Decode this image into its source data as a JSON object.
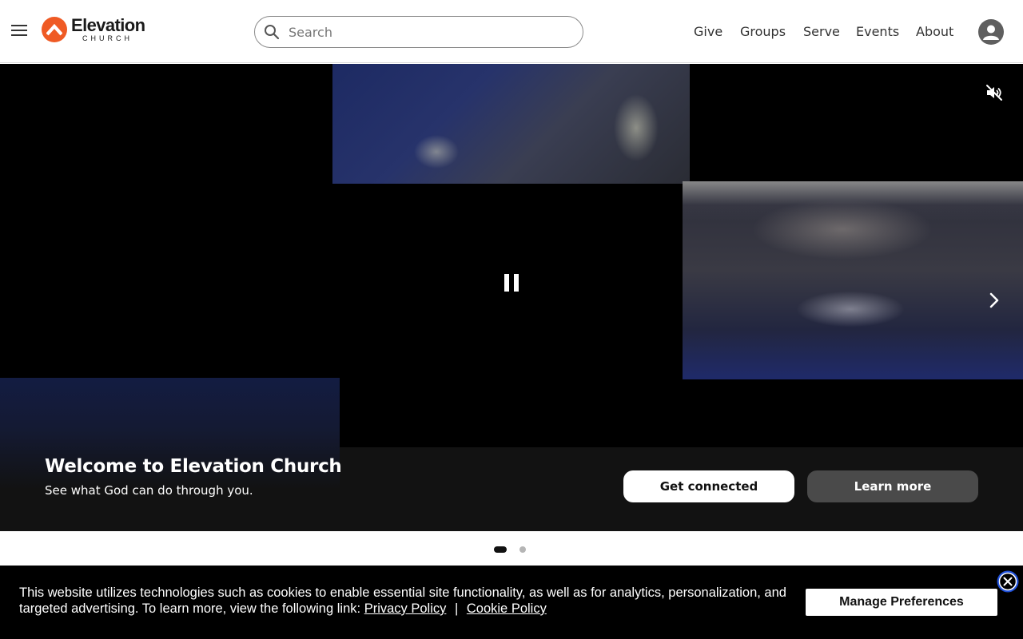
{
  "brand": {
    "name": "Elevation",
    "subname": "CHURCH",
    "accent_color": "#ef5a24"
  },
  "header": {
    "menu_icon": "hamburger-menu-icon",
    "search": {
      "placeholder": "Search",
      "value": "",
      "icon": "search-icon"
    },
    "nav": [
      {
        "label": "Give"
      },
      {
        "label": "Groups"
      },
      {
        "label": "Serve"
      },
      {
        "label": "Events"
      },
      {
        "label": "About"
      }
    ],
    "account_icon": "user-avatar-icon"
  },
  "hero": {
    "title": "Welcome to Elevation Church",
    "subtitle": "See what God can do through you.",
    "primary_button": "Get connected",
    "secondary_button": "Learn more",
    "icons": {
      "mute": "volume-muted-icon",
      "pause": "pause-icon",
      "next": "chevron-right-icon"
    }
  },
  "carousel": {
    "slide_count": 2,
    "active_slide": 1
  },
  "cookie_banner": {
    "text": "This website utilizes technologies such as cookies to enable essential site functionality, as well as for analytics, personalization, and targeted advertising. To learn more, view the following link:",
    "privacy_link": "Privacy Policy",
    "separator": "|",
    "cookie_link": "Cookie Policy",
    "manage_button": "Manage Preferences",
    "close_icon": "close-circle-icon"
  }
}
